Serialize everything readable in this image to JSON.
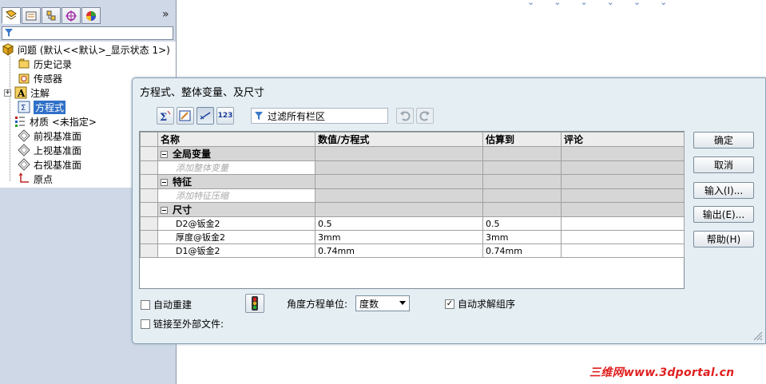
{
  "tree": {
    "root_label": "问题 (默认<<默认>_显示状态 1>)",
    "items": [
      {
        "label": "历史记录",
        "icon": "history-folder-icon"
      },
      {
        "label": "传感器",
        "icon": "sensor-icon"
      },
      {
        "label": "注解",
        "icon": "annotation-icon"
      },
      {
        "label": "方程式",
        "icon": "equation-icon"
      },
      {
        "label": "材质 <未指定>",
        "icon": "material-icon"
      },
      {
        "label": "前视基准面",
        "icon": "plane-icon"
      },
      {
        "label": "上视基准面",
        "icon": "plane-icon"
      },
      {
        "label": "右视基准面",
        "icon": "plane-icon"
      },
      {
        "label": "原点",
        "icon": "origin-icon"
      }
    ],
    "more_glyph": "»"
  },
  "dialog": {
    "title": "方程式、整体变量、及尺寸",
    "filter_text": "过滤所有栏区",
    "toolbar_123": "123",
    "columns": [
      "名称",
      "数值/方程式",
      "估算到",
      "评论"
    ],
    "sections": {
      "global": "全局变量",
      "global_hint": "添加整体变量",
      "features": "特征",
      "features_hint": "添加特征压缩",
      "dims": "尺寸"
    },
    "dimension_rows": [
      {
        "name": "D2@钣金2",
        "value": "0.5",
        "evaluates": "0.5"
      },
      {
        "name": "厚度@钣金2",
        "value": "3mm",
        "evaluates": "3mm"
      },
      {
        "name": "D1@钣金2",
        "value": "0.74mm",
        "evaluates": "0.74mm"
      }
    ],
    "buttons": {
      "ok": "确定",
      "cancel": "取消",
      "import": "输入(I)...",
      "export": "输出(E)...",
      "help": "帮助(H)"
    },
    "options": {
      "auto_rebuild": "自动重建",
      "auto_rebuild_checked": false,
      "link_external": "链接至外部文件:",
      "link_external_checked": false,
      "angle_unit_label": "角度方程单位:",
      "angle_unit_value": "度数",
      "auto_solve": "自动求解组序",
      "auto_solve_checked": true
    }
  },
  "watermark": "三维网www.3dportal.cn",
  "colors": {
    "selection": "#3070c8",
    "dialog_bg": "#e5eef3",
    "section_bg": "#d6d6d6",
    "watermark": "#e02020"
  }
}
